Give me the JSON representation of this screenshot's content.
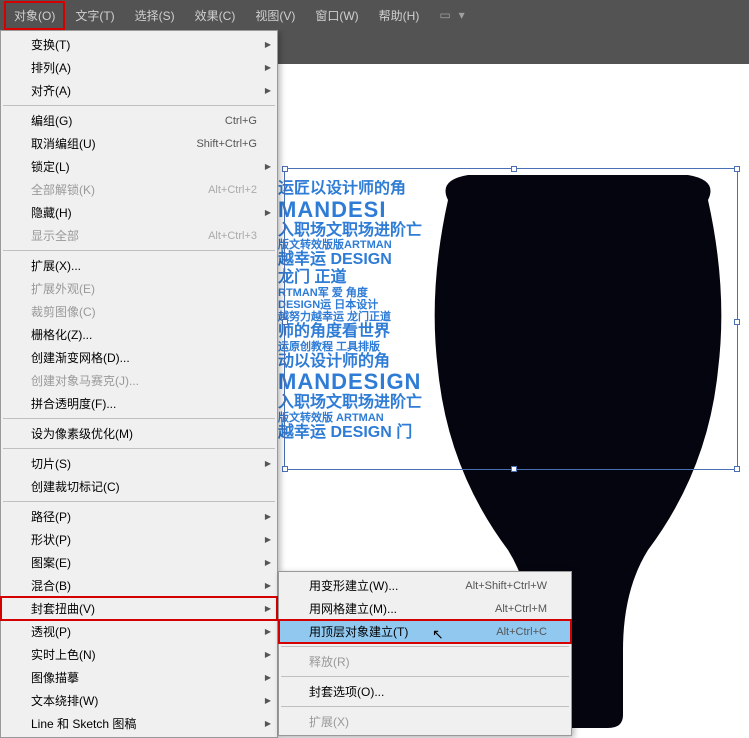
{
  "menubar": {
    "items": [
      {
        "label": "对象(O)",
        "highlighted": true
      },
      {
        "label": "文字(T)"
      },
      {
        "label": "选择(S)"
      },
      {
        "label": "效果(C)"
      },
      {
        "label": "视图(V)"
      },
      {
        "label": "窗口(W)"
      },
      {
        "label": "帮助(H)"
      }
    ]
  },
  "dropdown": {
    "groups": [
      [
        {
          "label": "变换(T)",
          "submenu": true
        },
        {
          "label": "排列(A)",
          "submenu": true
        },
        {
          "label": "对齐(A)",
          "submenu": true
        }
      ],
      [
        {
          "label": "编组(G)",
          "shortcut": "Ctrl+G"
        },
        {
          "label": "取消编组(U)",
          "shortcut": "Shift+Ctrl+G"
        },
        {
          "label": "锁定(L)",
          "submenu": true
        },
        {
          "label": "全部解锁(K)",
          "shortcut": "Alt+Ctrl+2",
          "disabled": true
        },
        {
          "label": "隐藏(H)",
          "submenu": true
        },
        {
          "label": "显示全部",
          "shortcut": "Alt+Ctrl+3",
          "disabled": true
        }
      ],
      [
        {
          "label": "扩展(X)..."
        },
        {
          "label": "扩展外观(E)",
          "disabled": true
        },
        {
          "label": "裁剪图像(C)",
          "disabled": true
        },
        {
          "label": "栅格化(Z)..."
        },
        {
          "label": "创建渐变网格(D)..."
        },
        {
          "label": "创建对象马赛克(J)...",
          "disabled": true
        },
        {
          "label": "拼合透明度(F)..."
        }
      ],
      [
        {
          "label": "设为像素级优化(M)"
        }
      ],
      [
        {
          "label": "切片(S)",
          "submenu": true
        },
        {
          "label": "创建裁切标记(C)"
        }
      ],
      [
        {
          "label": "路径(P)",
          "submenu": true
        },
        {
          "label": "形状(P)",
          "submenu": true
        },
        {
          "label": "图案(E)",
          "submenu": true
        },
        {
          "label": "混合(B)",
          "submenu": true
        },
        {
          "label": "封套扭曲(V)",
          "submenu": true,
          "highlighted": true
        },
        {
          "label": "透视(P)",
          "submenu": true
        },
        {
          "label": "实时上色(N)",
          "submenu": true
        },
        {
          "label": "图像描摹",
          "submenu": true
        },
        {
          "label": "文本绕排(W)",
          "submenu": true
        },
        {
          "label": "Line 和 Sketch 图稿",
          "submenu": true
        }
      ]
    ]
  },
  "submenu": {
    "groups": [
      [
        {
          "label": "用变形建立(W)...",
          "shortcut": "Alt+Shift+Ctrl+W"
        },
        {
          "label": "用网格建立(M)...",
          "shortcut": "Alt+Ctrl+M"
        },
        {
          "label": "用顶层对象建立(T)",
          "shortcut": "Alt+Ctrl+C",
          "hovered": true,
          "highlighted": true
        }
      ],
      [
        {
          "label": "释放(R)",
          "disabled": true
        }
      ],
      [
        {
          "label": "封套选项(O)..."
        }
      ],
      [
        {
          "label": "扩展(X)",
          "disabled": true
        }
      ]
    ]
  },
  "canvas": {
    "text_lines": [
      {
        "text": "运匠以设计师的角",
        "cls": "med"
      },
      {
        "text": "MANDESI",
        "cls": "big"
      },
      {
        "text": "入职场文职场进阶亡",
        "cls": "med"
      },
      {
        "text": "版文转效版版ARTMAN",
        "cls": "small"
      },
      {
        "text": "越幸运 DESIGN",
        "cls": "med"
      },
      {
        "text": "龙门 正道",
        "cls": "med"
      },
      {
        "text": "RTMAN军 爱 角度",
        "cls": "small"
      },
      {
        "text": "DESIGN运 日本设计",
        "cls": "small"
      },
      {
        "text": "越努力越幸运 龙门正道",
        "cls": "small"
      },
      {
        "text": "师的角度看世界",
        "cls": "med"
      },
      {
        "text": "运原创教程 工具排版",
        "cls": "small"
      },
      {
        "text": "动以设计师的角",
        "cls": "med"
      },
      {
        "text": "MANDESIGN",
        "cls": "big"
      },
      {
        "text": "入职场文职场进阶亡",
        "cls": "med"
      },
      {
        "text": "版文转效版 ARTMAN",
        "cls": "small"
      },
      {
        "text": "越幸运 DESIGN 门",
        "cls": "med"
      }
    ]
  }
}
